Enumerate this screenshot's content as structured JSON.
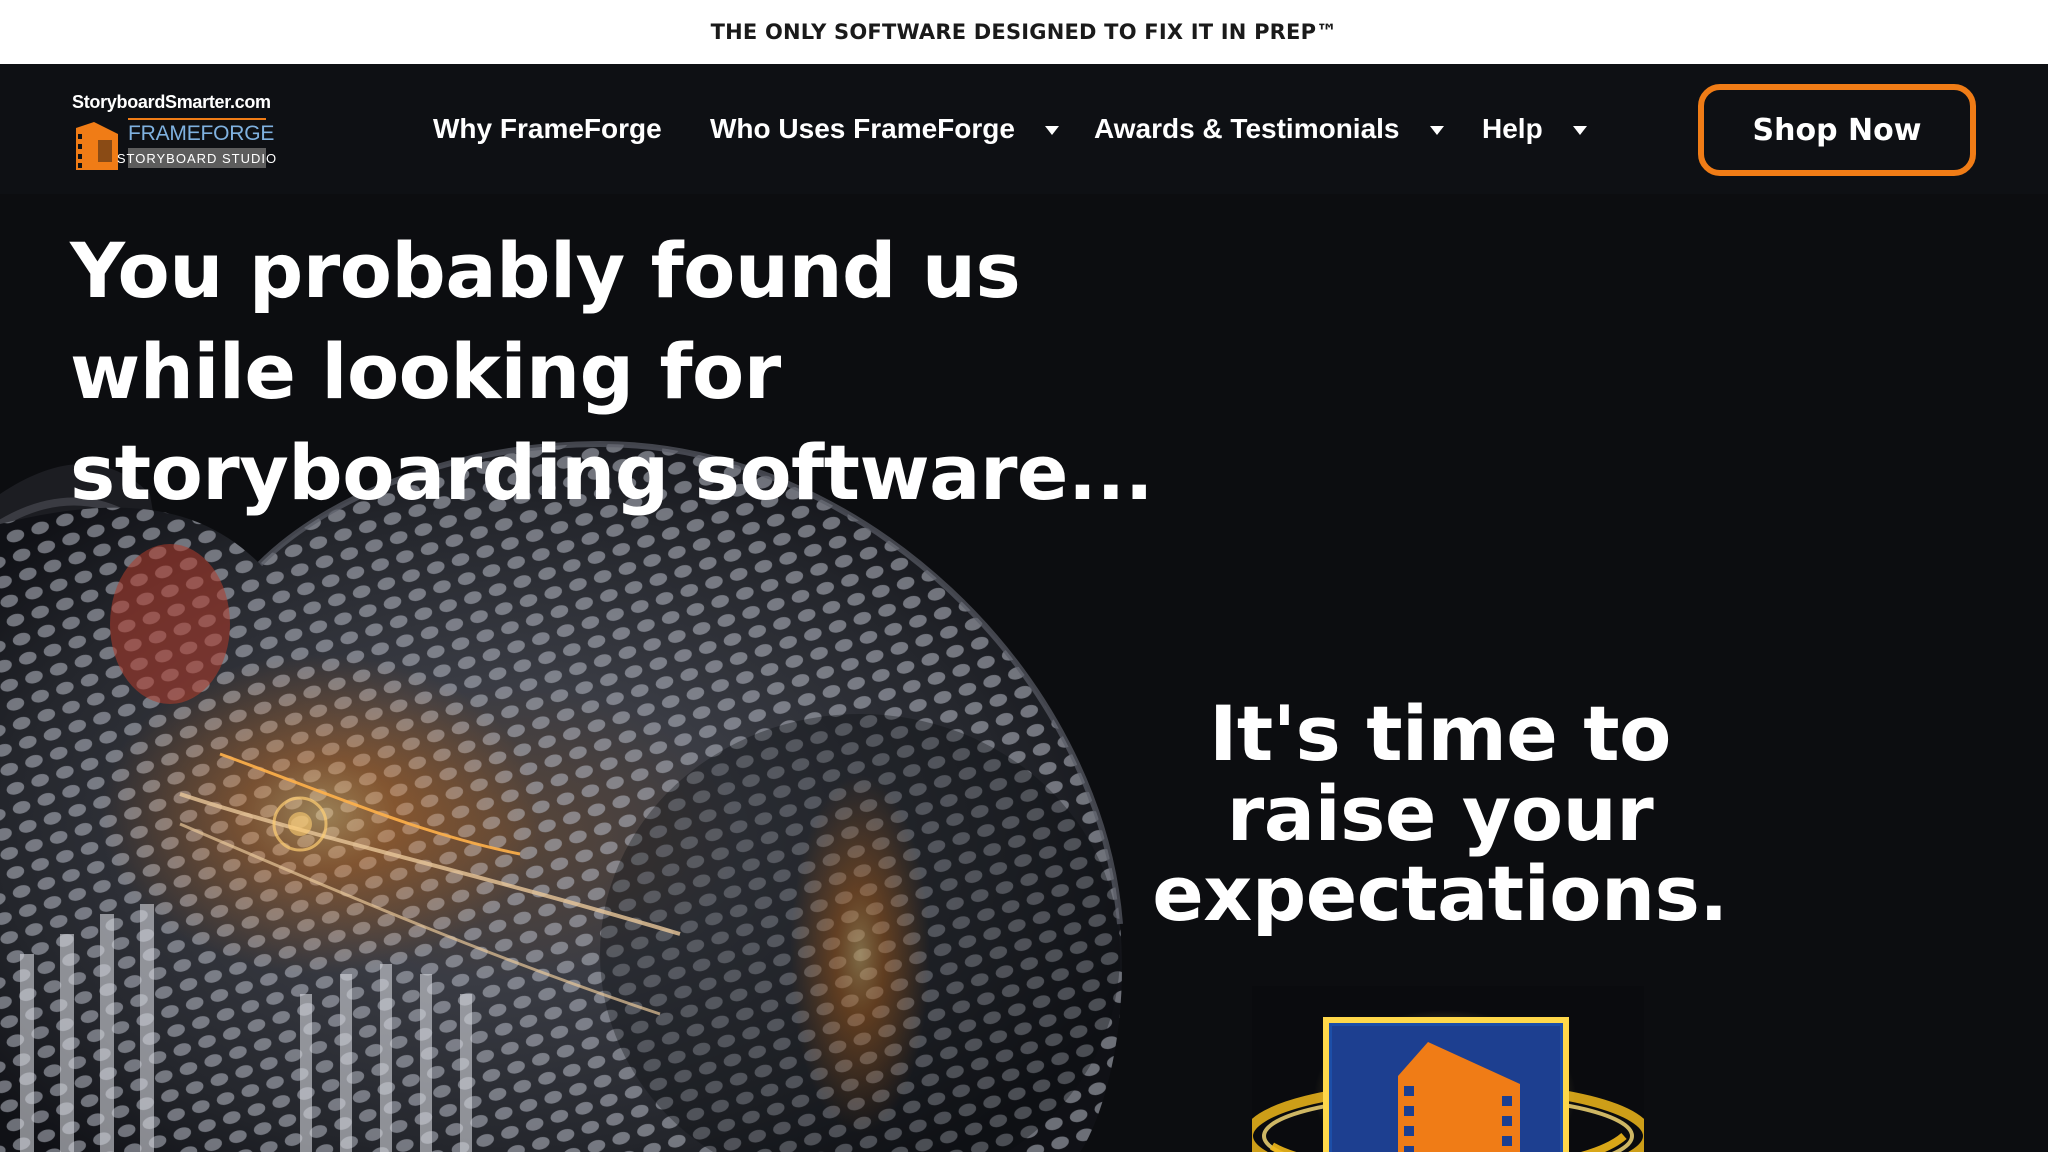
{
  "announcement": {
    "text": "THE ONLY SOFTWARE DESIGNED TO FIX IT IN PREP™"
  },
  "logo": {
    "site": "StoryboardSmarter.com",
    "name": "FRAMEFORGE",
    "subtitle": "STORYBOARD STUDIO"
  },
  "nav": {
    "items": [
      {
        "label": "Why FrameForge",
        "has_dropdown": false
      },
      {
        "label": "Who Uses FrameForge",
        "has_dropdown": true
      },
      {
        "label": "Awards & Testimonials",
        "has_dropdown": true
      },
      {
        "label": "Help",
        "has_dropdown": true
      }
    ],
    "cta_label": "Shop Now"
  },
  "hero": {
    "heading": "You probably found us while looking for storyboarding software...",
    "tagline": "It's time to raise your expectations."
  },
  "colors": {
    "accent": "#f07c16",
    "background": "#0c0d10",
    "nav_background": "#0e1014",
    "text": "#ffffff",
    "logo_blue": "#7fb1e0"
  },
  "icons": {
    "nav_dropdown": "caret-down-icon",
    "logo_mark": "film-strip-icon",
    "product_box": "film-clapper-box-icon"
  }
}
